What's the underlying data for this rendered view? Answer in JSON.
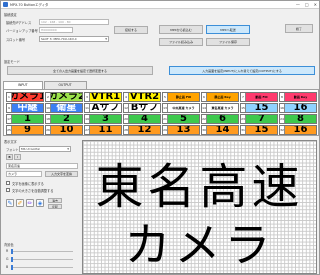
{
  "window": {
    "title": "MPX-70 Buttonエディタ",
    "controls": [
      "—",
      "□",
      "✕"
    ]
  },
  "connection": {
    "group_label": "接続設定",
    "address_label": "接続先IPアドレス",
    "address_value": "192 . 168 . 100 . 80",
    "apply_label": "接続する",
    "version_label": "バージョンアップ番号",
    "version_value": "H0000000",
    "slot_label": "スロット番号",
    "slot_value": "SLOT 3: MPX-70U-1KV-C",
    "mpx_load_label": "MPXから読込む",
    "mpx_send_label": "MPXへ転送",
    "file_read_label": "ファイル読み込み",
    "file_save_label": "ファイル保存",
    "close_label": "終了"
  },
  "mode": {
    "group_label": "設定モード",
    "left_button": "全ての入出力画面を設定で選択変更する",
    "right_button": "入力画面を設定(INPUT)に入れ替えて設定(OUTPUT)にする"
  },
  "tabs": [
    "INPUT",
    "OUTPUT"
  ],
  "buttons": [
    {
      "n": "1",
      "label": "カメラ1",
      "bg": "#ff3b2f",
      "fg": "#000000",
      "size": "big"
    },
    {
      "n": "2",
      "label": "カメラ2",
      "bg": "#9be34a",
      "fg": "#000000",
      "size": "big"
    },
    {
      "n": "3",
      "label": "VTR1",
      "bg": "#fff200",
      "fg": "#000000",
      "size": "big"
    },
    {
      "n": "4",
      "label": "VTR2",
      "bg": "#fff200",
      "fg": "#000000",
      "size": "big"
    },
    {
      "n": "5",
      "label": "静止画 Fill",
      "bg": "#ffa300",
      "fg": "#000000",
      "size": "sml"
    },
    {
      "n": "6",
      "label": "静止画 Key",
      "bg": "#ffa300",
      "fg": "#000000",
      "size": "sml"
    },
    {
      "n": "7",
      "label": "動画 Fill",
      "bg": "#ff3b6e",
      "fg": "#000000",
      "size": "sml"
    },
    {
      "n": "8",
      "label": "動画 Key",
      "bg": "#ff3b6e",
      "fg": "#000000",
      "size": "sml"
    },
    {
      "n": "9",
      "label": "中継",
      "bg": "#3c7ff2",
      "fg": "#ffffff",
      "size": "big"
    },
    {
      "n": "10",
      "label": "衛星",
      "bg": "#3c7ff2",
      "fg": "#ffffff",
      "size": "big"
    },
    {
      "n": "11",
      "label": "Aサブ",
      "bg": "#ffffff",
      "fg": "#000000",
      "size": "big"
    },
    {
      "n": "12",
      "label": "Bサブ",
      "bg": "#ffffff",
      "fg": "#000000",
      "size": "big"
    },
    {
      "n": "13",
      "label": "中央高速 カメラ",
      "bg": "#ffffff",
      "fg": "#000000",
      "size": "sml"
    },
    {
      "n": "14",
      "label": "東名高速 カメラ",
      "bg": "#ffffff",
      "fg": "#000000",
      "size": "sml"
    },
    {
      "n": "15",
      "label": "15",
      "bg": "#8fd3ff",
      "fg": "#000000",
      "size": "big"
    },
    {
      "n": "16",
      "label": "16",
      "bg": "#8fd3ff",
      "fg": "#000000",
      "size": "big"
    },
    {
      "n": "17",
      "label": "1",
      "bg": "#3ec94d",
      "fg": "#000000",
      "size": "big"
    },
    {
      "n": "18",
      "label": "2",
      "bg": "#3ec94d",
      "fg": "#000000",
      "size": "big"
    },
    {
      "n": "19",
      "label": "3",
      "bg": "#3ec94d",
      "fg": "#000000",
      "size": "big"
    },
    {
      "n": "20",
      "label": "4",
      "bg": "#3ec94d",
      "fg": "#000000",
      "size": "big"
    },
    {
      "n": "21",
      "label": "5",
      "bg": "#3ec94d",
      "fg": "#000000",
      "size": "big"
    },
    {
      "n": "22",
      "label": "6",
      "bg": "#3ec94d",
      "fg": "#000000",
      "size": "big"
    },
    {
      "n": "23",
      "label": "7",
      "bg": "#3ec94d",
      "fg": "#000000",
      "size": "big"
    },
    {
      "n": "24",
      "label": "8",
      "bg": "#3ec94d",
      "fg": "#000000",
      "size": "big"
    },
    {
      "n": "25",
      "label": "9",
      "bg": "#ff9a1f",
      "fg": "#000000",
      "size": "big"
    },
    {
      "n": "26",
      "label": "10",
      "bg": "#ff9a1f",
      "fg": "#000000",
      "size": "big"
    },
    {
      "n": "27",
      "label": "11",
      "bg": "#ff9a1f",
      "fg": "#000000",
      "size": "big"
    },
    {
      "n": "28",
      "label": "12",
      "bg": "#ff9a1f",
      "fg": "#000000",
      "size": "big"
    },
    {
      "n": "29",
      "label": "13",
      "bg": "#ff9a1f",
      "fg": "#000000",
      "size": "big"
    },
    {
      "n": "30",
      "label": "14",
      "bg": "#ff9a1f",
      "fg": "#000000",
      "size": "big"
    },
    {
      "n": "31",
      "label": "15",
      "bg": "#ff9a1f",
      "fg": "#000000",
      "size": "big"
    },
    {
      "n": "32",
      "label": "16",
      "bg": "#ff9a1f",
      "fg": "#000000",
      "size": "big"
    }
  ],
  "editor": {
    "group_label": "表示文字",
    "font_label": "フォント",
    "font_value": "MS UI Gothic",
    "bold_label": "B",
    "italic_label": "I",
    "text_line1": "東名高速",
    "text_line2": "カメラ",
    "input_label": "入力文字を変換",
    "check1": "文字を画像に表示する",
    "check2": "文字の大きさを自動調整する",
    "clear_label": "消去",
    "invert_label": "反転",
    "color_group_label": "背景色",
    "color_labels": [
      "R",
      "G",
      "B"
    ]
  },
  "preview": {
    "line1": "東名高速",
    "line2": "カメラ"
  }
}
